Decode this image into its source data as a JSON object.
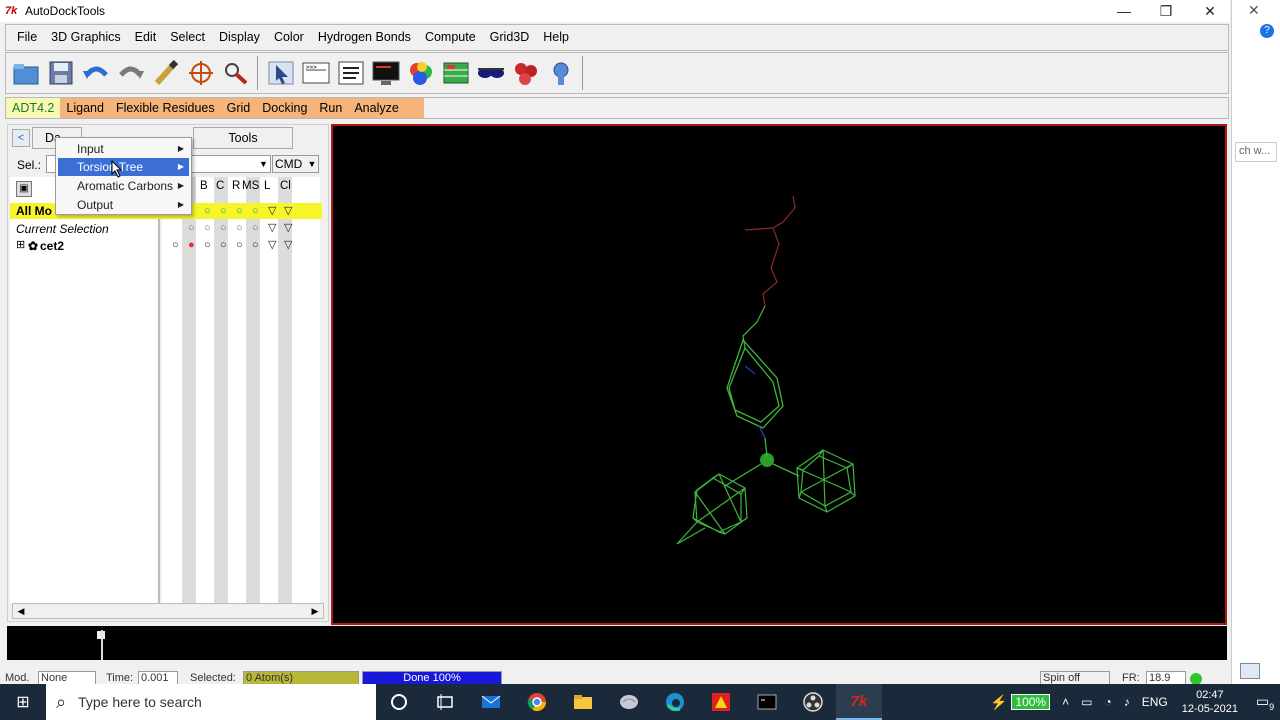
{
  "window": {
    "logo": "7k",
    "title": "AutoDockTools",
    "minimize": "—",
    "maximize": "❐",
    "close": "✕"
  },
  "browser_strip": {
    "close": "✕",
    "badge": "?",
    "search_text": "ch w..."
  },
  "menubar": [
    "File",
    "3D Graphics",
    "Edit",
    "Select",
    "Display",
    "Color",
    "Hydrogen Bonds",
    "Compute",
    "Grid3D",
    "Help"
  ],
  "toolbar": {
    "icons": [
      "open-folder-icon",
      "save-icon",
      "undo-icon",
      "redo-icon",
      "pencil-icon",
      "target-icon",
      "magnifier-icon",
      "pointer-icon",
      "python-shell-icon",
      "text-lines-icon",
      "monitor-icon",
      "color-spheres-icon",
      "grid-icon",
      "stereo-glasses-icon",
      "molecule-icon",
      "bug-report-icon"
    ]
  },
  "adt_menu": {
    "version": "ADT4.2",
    "items": [
      "Ligand",
      "Flexible Residues",
      "Grid",
      "Docking",
      "Run",
      "Analyze"
    ]
  },
  "dashboard": {
    "back_icon": "<",
    "tab_dashboard": "Da",
    "tab_tools": "Tools",
    "sel_label": "Sel.:",
    "sel_value": "",
    "cmd_value": "CMD",
    "dropdown_glyph": "▼",
    "column_headers": [
      "B",
      "C",
      "R",
      "MS",
      "L",
      "Cl"
    ],
    "rows": {
      "all_molecules": "All Mo",
      "current_selection": "Current Selection",
      "molecule": "cet2",
      "expand": "⊞"
    },
    "circle": "○",
    "filled_circle": "●",
    "triangle": "▽",
    "scroll_left": "◀",
    "scroll_right": "▶"
  },
  "popup_menu": {
    "items": [
      {
        "label": "Input",
        "highlighted": false
      },
      {
        "label": "Torsion Tree",
        "highlighted": true
      },
      {
        "label": "Aromatic Carbons",
        "highlighted": false
      },
      {
        "label": "Output",
        "highlighted": false
      }
    ],
    "arrow": "▶"
  },
  "viewer": {
    "background": "#000000",
    "border_color": "#b01818",
    "molecule_color": "#3cb83c",
    "hetero_color_o": "#8a2a2a",
    "hetero_color_n": "#2a3ab8"
  },
  "statusbar": {
    "mod_label": "Mod.",
    "mod_value": "None",
    "time_label": "Time:",
    "time_value": "0.001",
    "selected_label": "Selected:",
    "selected_value": "0 Atom(s)",
    "progress_text": "Done 100%",
    "progress": 1.0,
    "spin": "Spin off",
    "fr_label": "FR:",
    "fr_value": "18.9"
  },
  "taskbar": {
    "start_icon": "⊞",
    "search_icon": "⌕",
    "search_placeholder": "Type here to search",
    "apps": [
      "cortana-icon",
      "task-view-icon",
      "mail-icon",
      "chrome-icon",
      "file-explorer-icon",
      "brain-app-icon",
      "edge-icon",
      "acrobat-icon",
      "terminal-icon",
      "obs-icon",
      "autodocktools-icon"
    ],
    "battery": "100%",
    "language": "ENG",
    "time": "02:47",
    "date": "12-05-2021",
    "notifications": "9"
  }
}
